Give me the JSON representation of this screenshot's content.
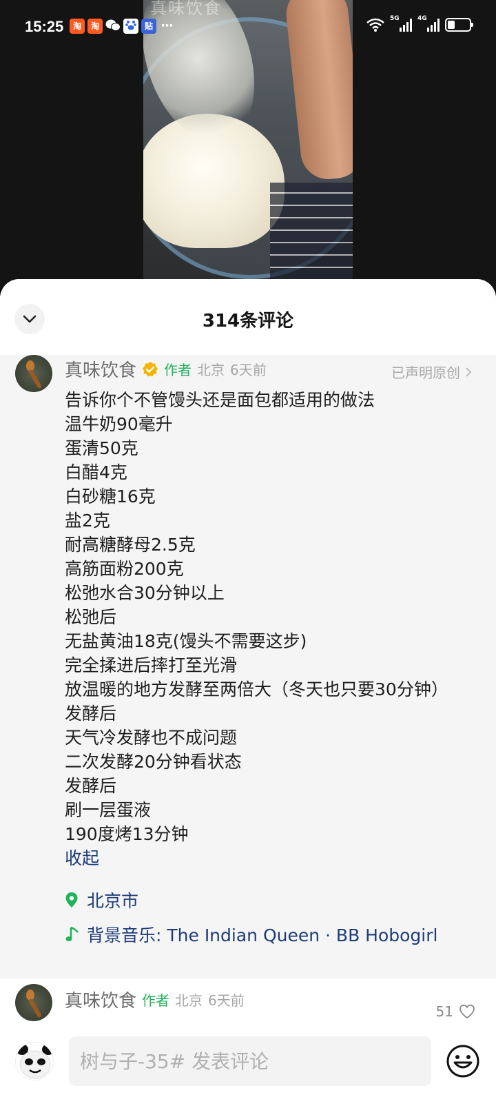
{
  "status_bar": {
    "time": "15:25",
    "notifications": [
      "taobao-red-icon",
      "taobao-red-icon",
      "wechat-icon",
      "baidu-icon",
      "tieba-icon",
      "more-dots-icon"
    ],
    "more": "···",
    "network": [
      "5G",
      "4G"
    ]
  },
  "video": {
    "watermark": "真味饮食"
  },
  "sheet": {
    "title": "314条评论"
  },
  "pinned_comment": {
    "author": "真味饮食",
    "author_tag": "作者",
    "location": "北京",
    "time": "6天前",
    "declared": "已声明原创",
    "lines": [
      "告诉你个不管馒头还是面包都适用的做法",
      "温牛奶90毫升",
      "蛋清50克",
      "白醋4克",
      "白砂糖16克",
      "盐2克",
      "耐高糖酵母2.5克",
      "高筋面粉200克",
      "松弛水合30分钟以上",
      "松弛后",
      "无盐黄油18克(馒头不需要这步)",
      "完全揉进后摔打至光滑",
      "放温暖的地方发酵至两倍大（冬天也只要30分钟）",
      "发酵后",
      "天气冷发酵也不成问题",
      "二次发酵20分钟看状态",
      "发酵后",
      "刷一层蛋液",
      "190度烤13分钟"
    ],
    "collapse": "收起",
    "place": "北京市",
    "music": "背景音乐: The Indian Queen · BB Hobogirl"
  },
  "second_comment": {
    "author": "真味饮食",
    "author_tag": "作者",
    "location": "北京",
    "time": "6天前",
    "likes": "51"
  },
  "input": {
    "placeholder": "树与子-35# 发表评论"
  },
  "colors": {
    "accent_green": "#23b15c",
    "link_blue": "#1d3c78",
    "verified_gold": "#f4b400"
  }
}
